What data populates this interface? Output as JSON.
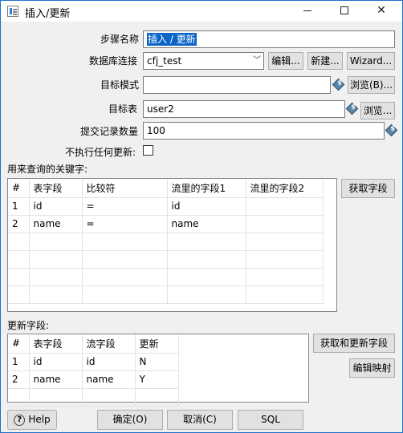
{
  "window": {
    "title": "插入/更新"
  },
  "form": {
    "step_name_label": "步骤名称",
    "step_name_value": "插入 / 更新",
    "db_conn_label": "数据库连接",
    "db_conn_value": "cfj_test",
    "edit_label": "编辑...",
    "new_label": "新建...",
    "wizard_label": "Wizard...",
    "target_schema_label": "目标模式",
    "target_schema_value": "",
    "browse_b_label": "浏览(B)...",
    "target_table_label": "目标表",
    "target_table_value": "user2",
    "browse_label": "浏览...",
    "commit_label": "提交记录数量",
    "commit_value": "100",
    "no_update_label": "不执行任何更新:"
  },
  "keys_section": {
    "label": "用来查询的关键字:",
    "get_fields_label": "获取字段",
    "columns": [
      "#",
      "表字段",
      "比较符",
      "流里的字段1",
      "流里的字段2"
    ],
    "rows": [
      [
        "1",
        "id",
        "=",
        "id",
        ""
      ],
      [
        "2",
        "name",
        "=",
        "name",
        ""
      ]
    ]
  },
  "update_section": {
    "label": "更新字段:",
    "get_update_label": "获取和更新字段",
    "edit_mapping_label": "编辑映射",
    "columns": [
      "#",
      "表字段",
      "流字段",
      "更新"
    ],
    "rows": [
      [
        "1",
        "id",
        "id",
        "N"
      ],
      [
        "2",
        "name",
        "name",
        "Y"
      ]
    ]
  },
  "footer": {
    "help_label": "Help",
    "ok_label": "确定(O)",
    "cancel_label": "取消(C)",
    "sql_label": "SQL"
  }
}
